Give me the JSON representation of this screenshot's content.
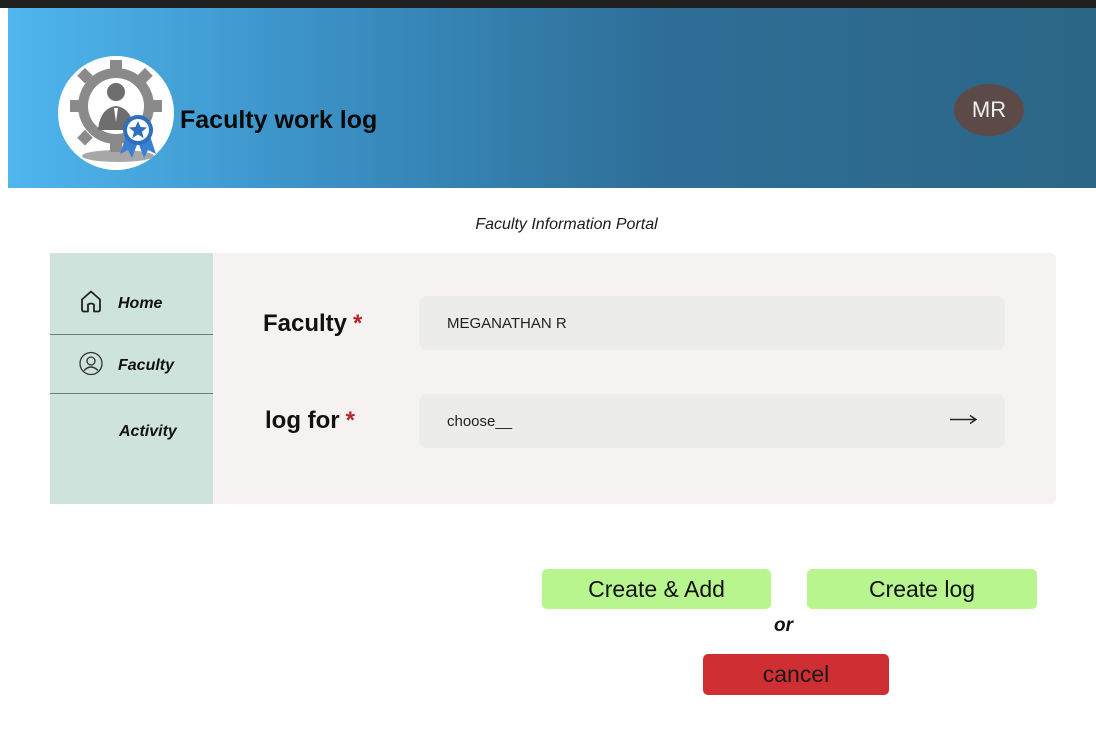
{
  "header": {
    "app_title": "Faculty work log",
    "avatar_initials": "MR",
    "gradient_start": "#4fb6ee",
    "gradient_end": "#2c6686"
  },
  "subtitle": "Faculty Information Portal",
  "sidebar": {
    "items": [
      {
        "label": "Home",
        "icon": "home-icon"
      },
      {
        "label": "Faculty",
        "icon": "user-circle-icon"
      },
      {
        "label": "Activity",
        "icon": ""
      }
    ]
  },
  "form": {
    "faculty_label": "Faculty",
    "faculty_value": "MEGANATHAN R",
    "log_for_label": "log for",
    "log_for_value": "choose__",
    "required_marker": "*"
  },
  "actions": {
    "create_add": "Create & Add",
    "create_log": "Create log",
    "or_text": "or",
    "cancel": "cancel"
  },
  "colors": {
    "sidebar_bg": "#cfe3dd",
    "panel_bg": "#f6f2f1",
    "primary_button": "#b8f58f",
    "cancel_button": "#cf2f33",
    "avatar_bg": "#5c4a49",
    "required": "#b3262b"
  }
}
